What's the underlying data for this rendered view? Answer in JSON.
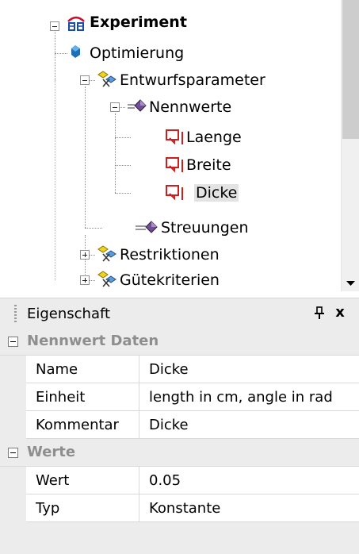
{
  "tree": {
    "root": {
      "label": "Experiment",
      "expanded": true,
      "icon": "experiment-icon"
    },
    "items": [
      {
        "label": "Optimierung",
        "icon": "optimization-icon"
      },
      {
        "label": "Entwurfsparameter",
        "expanded": true,
        "icon": "parameter-icon"
      },
      {
        "label": "Nennwerte",
        "expanded": true,
        "icon": "nominal-values-icon"
      },
      {
        "label": "Laenge",
        "icon": "parameter-value-icon"
      },
      {
        "label": "Breite",
        "icon": "parameter-value-icon"
      },
      {
        "label": "Dicke",
        "icon": "parameter-value-icon",
        "selected": true
      },
      {
        "label": "Streuungen",
        "icon": "variations-icon"
      },
      {
        "label": "Restriktionen",
        "expanded": false,
        "icon": "parameter-icon"
      },
      {
        "label": "Gütekriterien",
        "expanded": false,
        "icon": "parameter-icon"
      }
    ]
  },
  "properties": {
    "title": "Eigenschaft",
    "pin_glyph": "Ȅ",
    "close_glyph": "x",
    "categories": [
      {
        "label": "Nennwert Daten",
        "rows": [
          {
            "name": "Name",
            "value": "Dicke"
          },
          {
            "name": "Einheit",
            "value": "length in cm, angle in rad"
          },
          {
            "name": "Kommentar",
            "value": "Dicke"
          }
        ]
      },
      {
        "label": "Werte",
        "rows": [
          {
            "name": "Wert",
            "value": "0.05"
          },
          {
            "name": "Typ",
            "value": "Konstante"
          }
        ]
      }
    ]
  },
  "colors": {
    "panel_bg": "#ececec",
    "category_text": "#8e8e8e",
    "selection_bg": "#e3e3e3",
    "value_icon_red": "#cc1f1f",
    "experiment_icon": "#c8102e"
  }
}
